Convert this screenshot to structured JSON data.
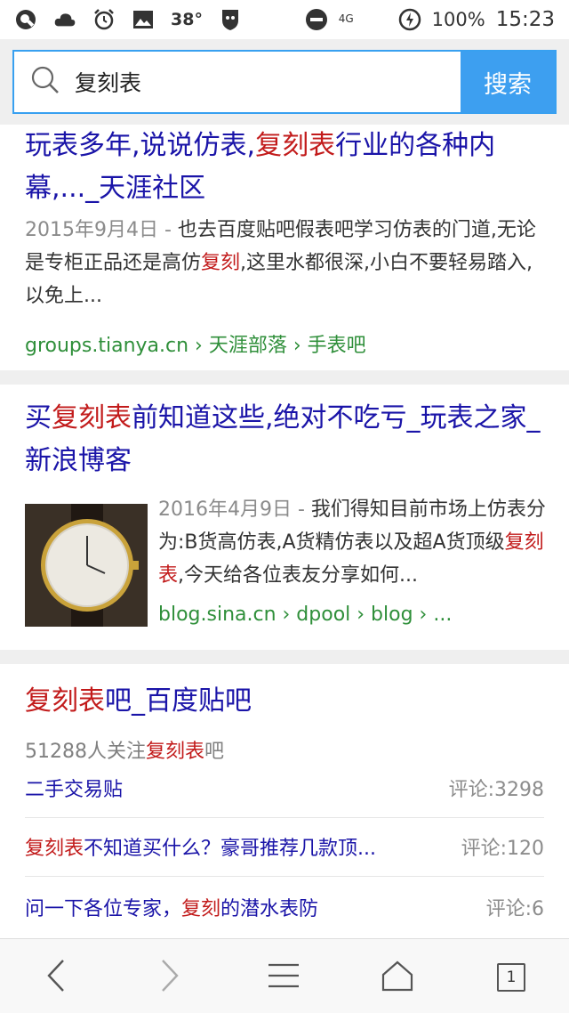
{
  "status_bar": {
    "temperature": "38°",
    "network": "4G",
    "battery": "100%",
    "time": "15:23"
  },
  "search": {
    "query": "复刻表",
    "button_label": "搜索"
  },
  "results": [
    {
      "title_parts": [
        "玩表多年,说说仿表,",
        "复刻表",
        "行业的各种内幕,..._天涯社区"
      ],
      "date": "2015年9月4日 -",
      "snippet_parts": [
        "也去百度贴吧假表吧学习仿表的门道,无论是专柜正品还是高仿",
        "复刻",
        ",这里水都很深,小白不要轻易踏入,以免上..."
      ],
      "source": "groups.tianya.cn › 天涯部落 › 手表吧"
    },
    {
      "title_parts": [
        "买",
        "复刻表",
        "前知道这些,绝对不吃亏_玩表之家_新浪博客"
      ],
      "date": "2016年4月9日 -",
      "snippet_parts": [
        "我们得知目前市场上仿表分为:B货高仿表,A货精仿表以及超A货顶级",
        "复刻表",
        ",今天给各位表友分享如何..."
      ],
      "source": "blog.sina.cn › dpool › blog › ..."
    }
  ],
  "tieba": {
    "title_hl": "复刻表",
    "title_rest": "吧_百度贴吧",
    "followers_pre": "51288人关注",
    "followers_hl": "复刻表",
    "followers_post": "吧",
    "posts": [
      {
        "pre": "二手交易贴",
        "hl": "",
        "post": "",
        "comments": "评论:3298"
      },
      {
        "pre": "",
        "hl": "复刻表",
        "post": "不知道买什么？豪哥推荐几款顶...",
        "comments": "评论:120"
      },
      {
        "pre": "问一下各位专家，",
        "hl": "复刻",
        "post": "的潜水表防",
        "comments": "评论:6"
      }
    ]
  },
  "tabs_count": "1",
  "colors": {
    "title_blue": "#1a14a8",
    "highlight_red": "#c21b1b",
    "url_green": "#2f8f3a",
    "search_blue": "#3d9ff0"
  }
}
